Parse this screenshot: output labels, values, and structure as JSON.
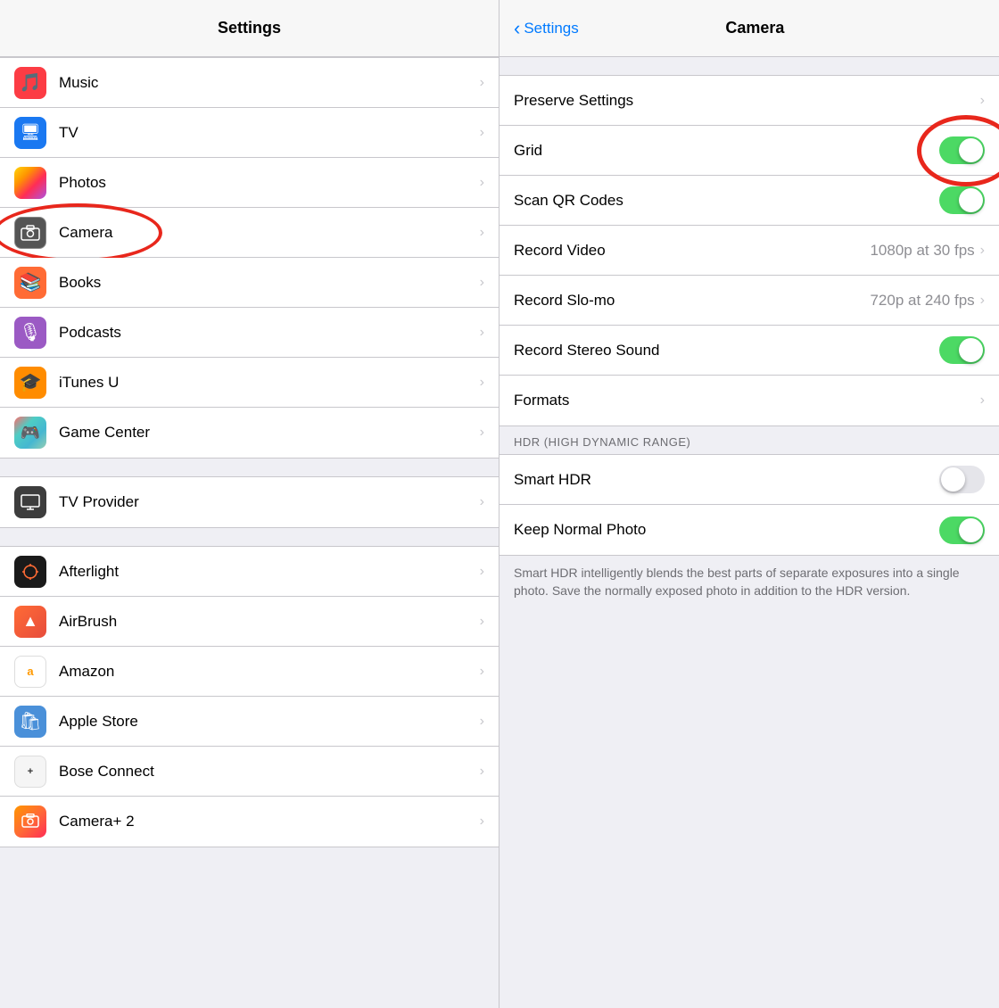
{
  "left": {
    "header": "Settings",
    "items": [
      {
        "id": "music",
        "label": "Music",
        "iconType": "music",
        "emoji": "🎵"
      },
      {
        "id": "tv",
        "label": "TV",
        "iconType": "tv",
        "emoji": "🖥"
      },
      {
        "id": "photos",
        "label": "Photos",
        "iconType": "photos",
        "emoji": "📷"
      },
      {
        "id": "camera",
        "label": "Camera",
        "iconType": "camera",
        "emoji": "📷",
        "circled": true
      },
      {
        "id": "books",
        "label": "Books",
        "iconType": "books",
        "emoji": "📚"
      },
      {
        "id": "podcasts",
        "label": "Podcasts",
        "iconType": "podcasts",
        "emoji": "🎙"
      },
      {
        "id": "itunesu",
        "label": "iTunes U",
        "iconType": "itunesu",
        "emoji": "🎓"
      },
      {
        "id": "gamecenter",
        "label": "Game Center",
        "iconType": "gamecenter",
        "emoji": "🎮"
      }
    ],
    "items2": [
      {
        "id": "tvprovider",
        "label": "TV Provider",
        "iconType": "tvprovider"
      }
    ],
    "items3": [
      {
        "id": "afterlight",
        "label": "Afterlight",
        "iconType": "afterlight",
        "emoji": "⬡"
      },
      {
        "id": "airbrush",
        "label": "AirBrush",
        "iconType": "airbrush",
        "emoji": "▲"
      },
      {
        "id": "amazon",
        "label": "Amazon",
        "iconType": "amazon"
      },
      {
        "id": "applestore",
        "label": "Apple Store",
        "iconType": "applestore",
        "emoji": "🛍"
      },
      {
        "id": "bose",
        "label": "Bose Connect",
        "iconType": "bose"
      },
      {
        "id": "cameraplusplus",
        "label": "Camera+ 2",
        "iconType": "cameraplusplus",
        "emoji": "📷"
      }
    ]
  },
  "right": {
    "header": "Camera",
    "back_label": "Settings",
    "rows": [
      {
        "id": "preserve",
        "label": "Preserve Settings",
        "type": "chevron"
      },
      {
        "id": "grid",
        "label": "Grid",
        "type": "toggle",
        "value": true,
        "circled": true
      },
      {
        "id": "scanqr",
        "label": "Scan QR Codes",
        "type": "toggle",
        "value": true
      },
      {
        "id": "recordvideo",
        "label": "Record Video",
        "type": "value-chevron",
        "value": "1080p at 30 fps"
      },
      {
        "id": "recordslomo",
        "label": "Record Slo-mo",
        "type": "value-chevron",
        "value": "720p at 240 fps"
      },
      {
        "id": "recordstereo",
        "label": "Record Stereo Sound",
        "type": "toggle",
        "value": true
      },
      {
        "id": "formats",
        "label": "Formats",
        "type": "chevron"
      }
    ],
    "hdr_section_label": "HDR (HIGH DYNAMIC RANGE)",
    "hdr_rows": [
      {
        "id": "smarthdr",
        "label": "Smart HDR",
        "type": "toggle",
        "value": false
      },
      {
        "id": "keepnormal",
        "label": "Keep Normal Photo",
        "type": "toggle",
        "value": true
      }
    ],
    "hdr_description": "Smart HDR intelligently blends the best parts of separate exposures into a single photo. Save the normally exposed photo in addition to the HDR version."
  }
}
